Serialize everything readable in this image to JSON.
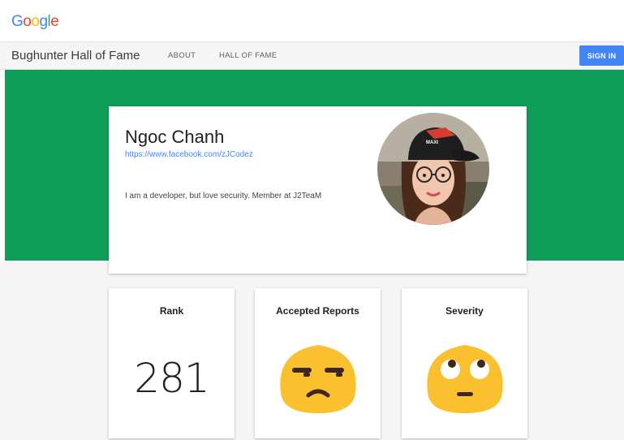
{
  "google_bar": {
    "logo_letters": [
      "G",
      "o",
      "o",
      "g",
      "l",
      "e"
    ]
  },
  "header": {
    "title": "Bughunter Hall of Fame",
    "nav": {
      "about": "ABOUT",
      "hall_of_fame": "HALL OF FAME"
    },
    "sign_in": "SIGN IN"
  },
  "profile": {
    "name": "Ngoc Chanh",
    "link": "https://www.facebook.com/zJCodez",
    "bio": "I am a developer, but love security. Member at J2TeaM",
    "cap_text": "MAXI"
  },
  "stats": {
    "rank": {
      "title": "Rank",
      "value": "281"
    },
    "accepted_reports": {
      "title": "Accepted Reports",
      "icon": "unamused-face-icon"
    },
    "severity": {
      "title": "Severity",
      "icon": "eye-roll-face-icon"
    }
  },
  "colors": {
    "brand_green": "#0f9d58",
    "primary_blue": "#4285F4",
    "emoji_yellow": "#fbc02d"
  }
}
